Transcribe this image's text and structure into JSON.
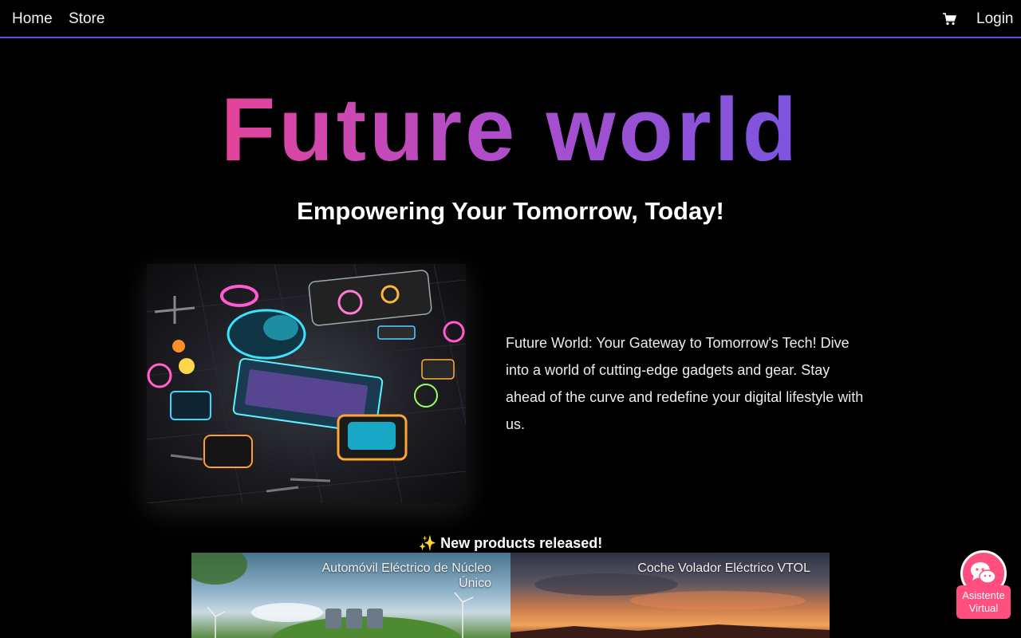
{
  "navbar": {
    "home_label": "Home",
    "store_label": "Store",
    "login_label": "Login",
    "cart_icon": "shopping-cart-icon",
    "accent_color": "#5b4de8"
  },
  "hero": {
    "title": "Future world",
    "subtitle": "Empowering Your Tomorrow, Today!",
    "description": "Future World: Your Gateway to Tomorrow's Tech! Dive into a world of cutting-edge gadgets and gear. Stay ahead of the curve and redefine your digital lifestyle with us.",
    "title_gradient": [
      "#e4449a",
      "#b24dc9",
      "#7b55e0"
    ]
  },
  "products": {
    "heading": "✨ New products released!",
    "items": [
      {
        "name": "Automóvil Eléctrico de Núcleo Único"
      },
      {
        "name": "Coche Volador Eléctrico VTOL"
      }
    ]
  },
  "assistant": {
    "label": "Asistente Virtual",
    "icon": "chat-bubbles-icon",
    "color": "#ff4f7f"
  }
}
